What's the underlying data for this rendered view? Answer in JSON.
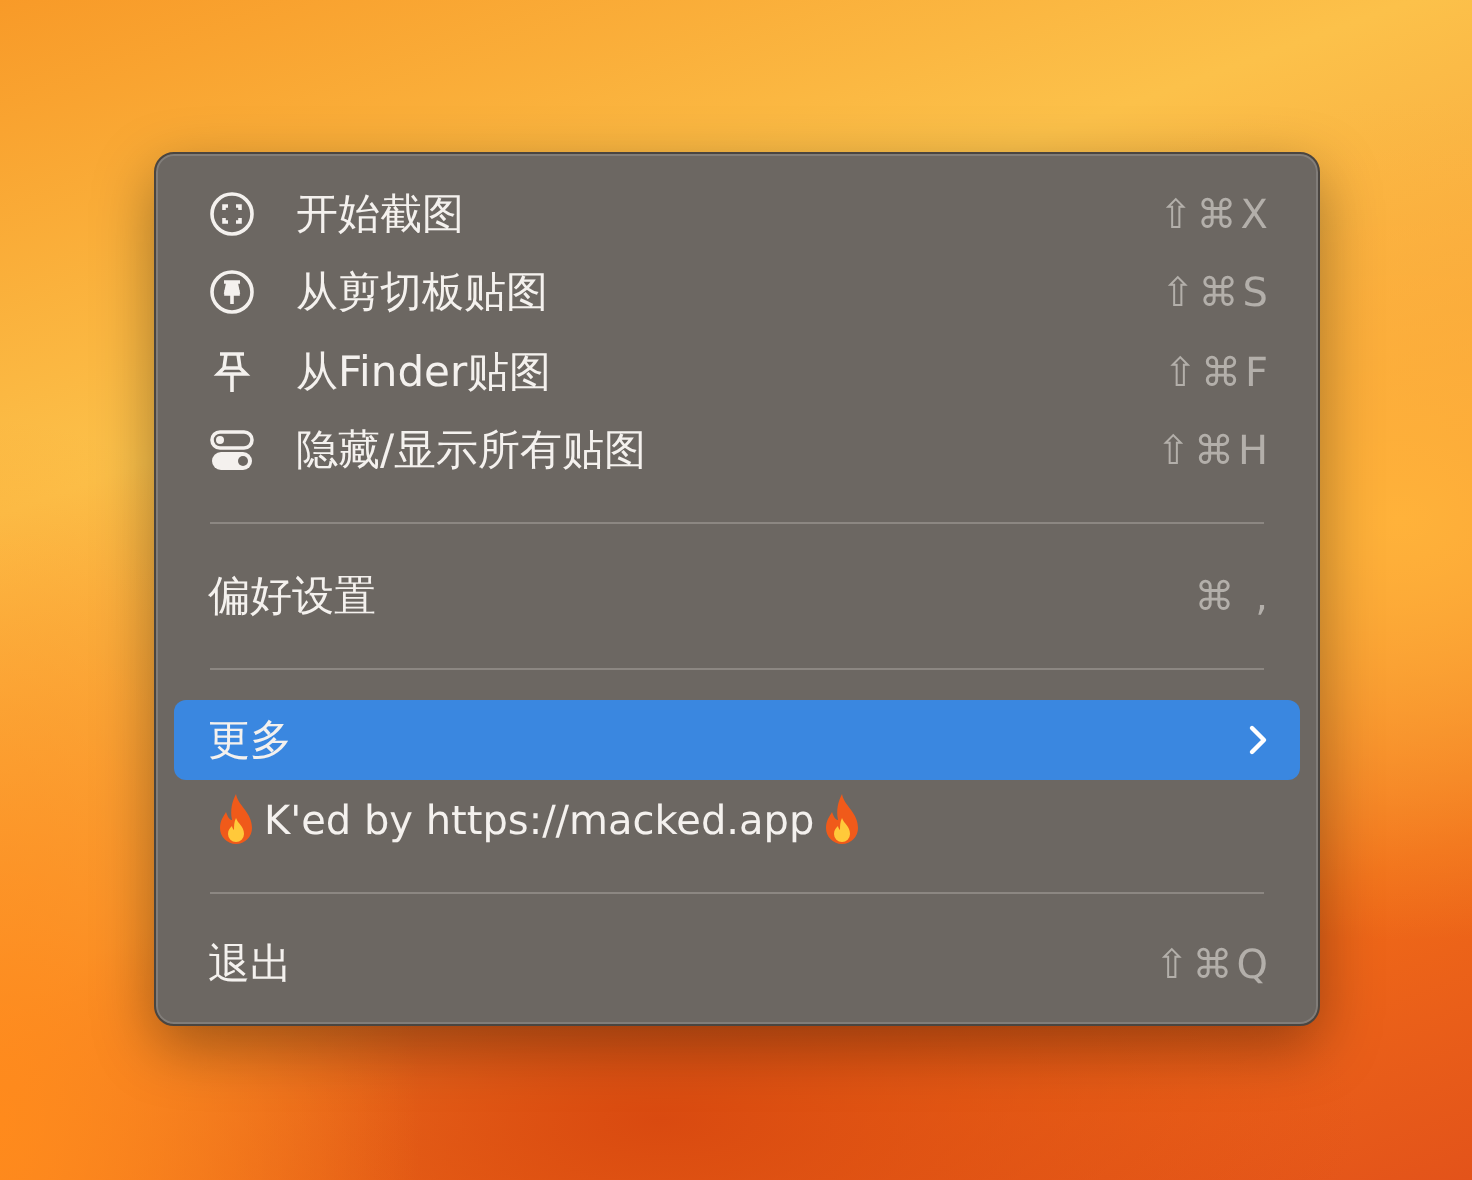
{
  "menu": {
    "items": [
      {
        "kind": "icon-item",
        "label": "开始截图",
        "shortcut": "⇧⌘X",
        "selected": false
      },
      {
        "kind": "icon-item",
        "label": "从剪切板贴图",
        "shortcut": "⇧⌘S",
        "selected": false
      },
      {
        "kind": "icon-item",
        "label": "从Finder贴图",
        "shortcut": "⇧⌘F",
        "selected": false
      },
      {
        "kind": "icon-item",
        "label": "隐藏/显示所有贴图",
        "shortcut": "⇧⌘H",
        "selected": false
      },
      {
        "kind": "separator"
      },
      {
        "kind": "plain",
        "label": "偏好设置",
        "shortcut": "⌘ ,",
        "selected": false
      },
      {
        "kind": "separator"
      },
      {
        "kind": "submenu",
        "label": "更多",
        "selected": true
      },
      {
        "kind": "banner",
        "label": "K'ed by https://macked.app",
        "selected": false
      },
      {
        "kind": "separator"
      },
      {
        "kind": "plain",
        "label": "退出",
        "shortcut": "⇧⌘Q",
        "selected": false
      }
    ]
  }
}
